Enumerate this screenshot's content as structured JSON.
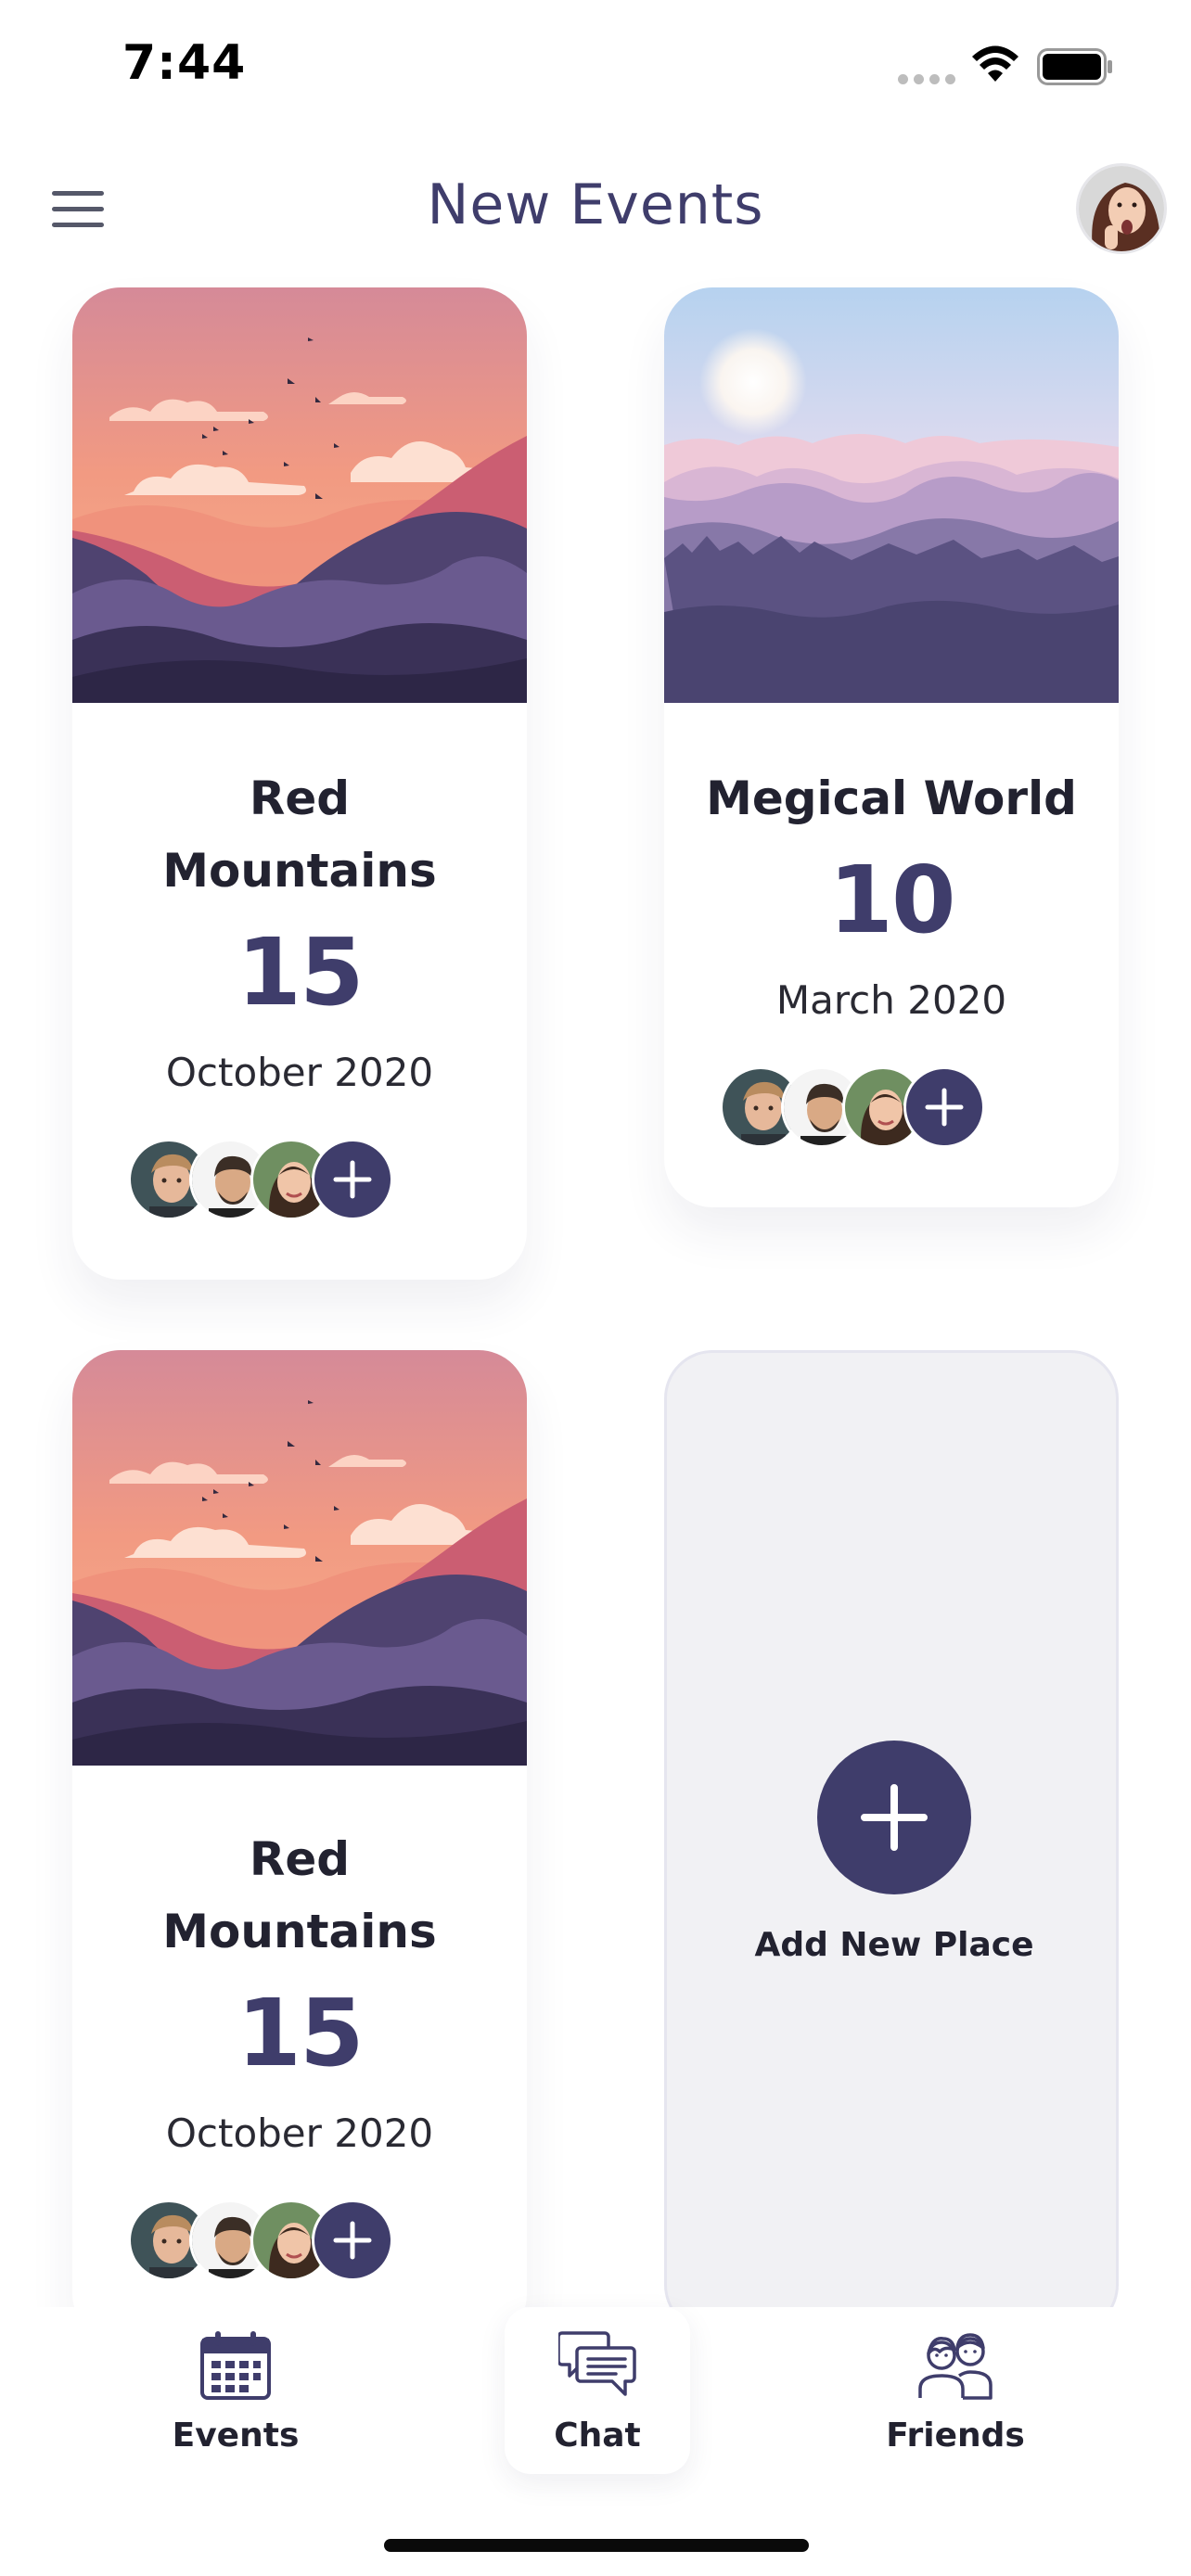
{
  "status_bar": {
    "time": "7:44"
  },
  "header": {
    "title": "New Events"
  },
  "events": [
    {
      "title_line1": "Red",
      "title_line2": "Mountains",
      "day": "15",
      "month": "October 2020"
    },
    {
      "title_line1": "Megical World",
      "title_line2": "",
      "day": "10",
      "month": "March 2020"
    },
    {
      "title_line1": "Red",
      "title_line2": "Mountains",
      "day": "15",
      "month": "October 2020"
    }
  ],
  "add_card": {
    "label": "Add New Place"
  },
  "bottom_nav": {
    "items": [
      {
        "label": "Events",
        "icon": "calendar-icon"
      },
      {
        "label": "Chat",
        "icon": "chat-icon"
      },
      {
        "label": "Friends",
        "icon": "friends-icon"
      }
    ],
    "active_item": "Chat"
  },
  "colors": {
    "primary": "#3f3d6b",
    "card_background": "#ffffff",
    "add_card_background": "#f1f1f4",
    "sunset_top": "#e89a8c",
    "mist_top": "#b8d3ef"
  }
}
